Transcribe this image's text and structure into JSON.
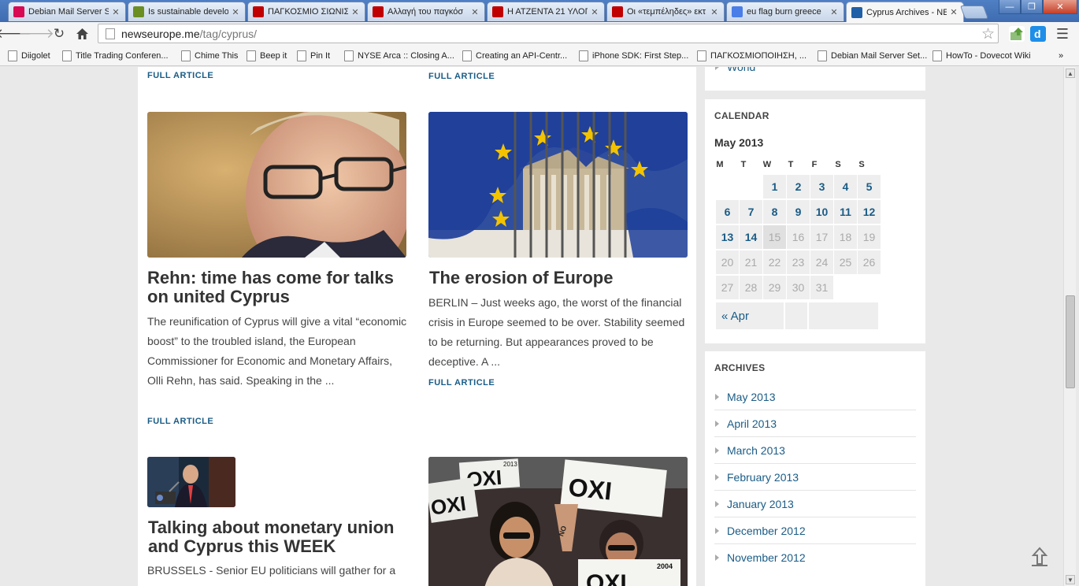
{
  "browser": {
    "tabs": [
      {
        "title": "Debian Mail Server S",
        "favicon": "debian-icon",
        "color": "#d70a53"
      },
      {
        "title": "Is sustainable develo",
        "favicon": "tree-icon",
        "color": "#6b8e23"
      },
      {
        "title": "ΠΑΓΚΟΣΜΙΟ ΣΙΩΝΙΣ",
        "favicon": "red-site-icon",
        "color": "#c00000"
      },
      {
        "title": "Αλλαγή του παγκόσ",
        "favicon": "red-site-icon",
        "color": "#c00000"
      },
      {
        "title": "Η ΑΤΖΕΝΤΑ 21 ΥΛΟΠ",
        "favicon": "red-site-icon",
        "color": "#c00000"
      },
      {
        "title": "Οι «τεμπέληδες» εκτ",
        "favicon": "red-site-icon",
        "color": "#c00000"
      },
      {
        "title": "eu flag burn greece",
        "favicon": "google-icon",
        "color": "#4a7de8"
      },
      {
        "title": "Cyprus Archives - NE",
        "favicon": "newseurope-icon",
        "color": "#1f5fa8"
      }
    ],
    "url": {
      "host": "newseurope.me",
      "path": "/tag/cyprus/"
    },
    "bookmarks": [
      "Diigolet",
      "Title Trading Conferen...",
      "Chime This",
      "Beep it",
      "Pin It",
      "NYSE Arca :: Closing A...",
      "Creating an API-Centr...",
      "iPhone SDK: First Step...",
      "ΠΑΓΚΟΣΜΙΟΠΟΙΗΣΗ, ...",
      "Debian Mail Server Set...",
      "HowTo - Dovecot Wiki"
    ],
    "bookmarks_overflow": "»"
  },
  "articles": {
    "prev_left_link": "FULL ARTICLE",
    "prev_right_link": "FULL ARTICLE",
    "rehn": {
      "title": "Rehn: time has come for talks on united Cyprus",
      "excerpt": "The reunification of Cyprus will give a vital “economic boost” to the troubled island, the European Commissioner for Economic and Monetary Affairs, Olli Rehn, has said. Speaking in the ...",
      "link": "FULL ARTICLE"
    },
    "erosion": {
      "title": "The erosion of Europe",
      "excerpt": "BERLIN – Just weeks ago, the worst of the financial crisis in Europe seemed to be over. Stability seemed to be returning. But appearances proved to be deceptive. A ...",
      "link": "FULL ARTICLE"
    },
    "monetary": {
      "title": "Talking about monetary union and Cyprus this WEEK",
      "excerpt": "BRUSSELS - Senior EU politicians will gather for a"
    },
    "protest_signs": [
      "OXI",
      "OXI",
      "OXI",
      "2013",
      "2004",
      "NO"
    ]
  },
  "sidebar": {
    "prev_widget_tail": "World",
    "calendar": {
      "heading": "CALENDAR",
      "month": "May 2013",
      "weekdays": [
        "M",
        "T",
        "W",
        "T",
        "F",
        "S",
        "S"
      ],
      "rows": [
        [
          "",
          "",
          "1",
          "2",
          "3",
          "4",
          "5"
        ],
        [
          "6",
          "7",
          "8",
          "9",
          "10",
          "11",
          "12"
        ],
        [
          "13",
          "14",
          "15",
          "16",
          "17",
          "18",
          "19"
        ],
        [
          "20",
          "21",
          "22",
          "23",
          "24",
          "25",
          "26"
        ],
        [
          "27",
          "28",
          "29",
          "30",
          "31",
          "",
          ""
        ]
      ],
      "linked_days": [
        "1",
        "2",
        "3",
        "4",
        "5",
        "6",
        "7",
        "8",
        "9",
        "10",
        "11",
        "12",
        "13",
        "14"
      ],
      "today": "15",
      "prev_link": "« Apr"
    },
    "archives": {
      "heading": "ARCHIVES",
      "items": [
        "May 2013",
        "April 2013",
        "March 2013",
        "February 2013",
        "January 2013",
        "December 2012",
        "November 2012"
      ]
    }
  },
  "colors": {
    "link": "#1a5c86",
    "title": "#333333",
    "chrome_blue": "#4f7fc4"
  }
}
